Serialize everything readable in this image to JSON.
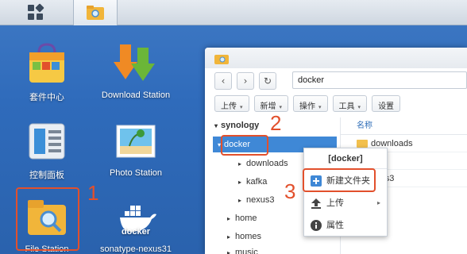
{
  "desktop": {
    "icons": [
      {
        "label": "套件中心"
      },
      {
        "label": "Download Station"
      },
      {
        "label": "控制面板"
      },
      {
        "label": "Photo Station"
      },
      {
        "label": "File Station"
      },
      {
        "label": "sonatype-nexus31"
      }
    ],
    "docker_logo_text": "docker"
  },
  "annotations": {
    "one": "1",
    "two": "2",
    "three": "3"
  },
  "file_station": {
    "path": "docker",
    "toolbar": {
      "upload": "上传",
      "new": "新增",
      "action": "操作",
      "tools": "工具",
      "settings": "设置"
    },
    "tree": {
      "root": "synology",
      "selected": "docker",
      "children": [
        "downloads",
        "kafka",
        "nexus3"
      ],
      "others": [
        "home",
        "homes",
        "music"
      ]
    },
    "list": {
      "header": "名称",
      "rows": [
        "downloads",
        "afka",
        "exus3"
      ]
    }
  },
  "context_menu": {
    "title": "[docker]",
    "items": {
      "new_folder": "新建文件夹",
      "upload": "上传",
      "properties": "属性"
    }
  },
  "colors": {
    "accent": "#3f88d6",
    "annotation": "#e2502c",
    "desktop": "#2f6bbb"
  }
}
